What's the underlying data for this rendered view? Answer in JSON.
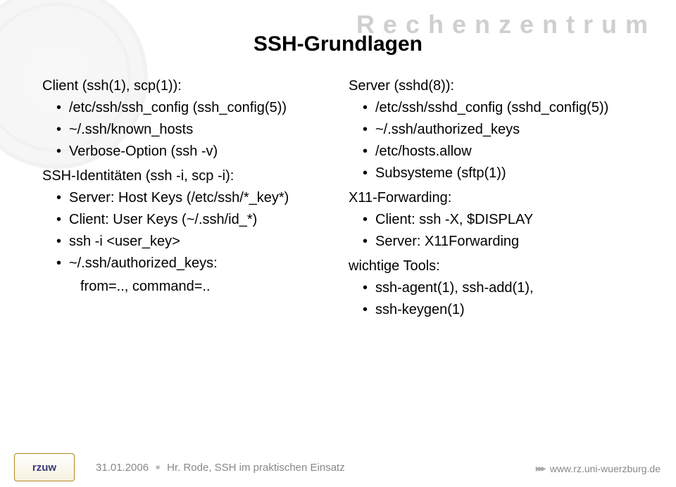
{
  "brand": "Rechenzentrum",
  "title": "SSH-Grundlagen",
  "left": {
    "s1": {
      "head": "Client (ssh(1), scp(1)):",
      "i0": "/etc/ssh/ssh_config (ssh_config(5))",
      "i1": "~/.ssh/known_hosts",
      "i2": "Verbose-Option (ssh -v)"
    },
    "s2": {
      "head": "SSH-Identitäten (ssh -i, scp -i):",
      "i0": "Server: Host Keys (/etc/ssh/*_key*)",
      "i1": "Client: User Keys (~/.ssh/id_*)",
      "i2": "ssh -i <user_key>",
      "i3": "~/.ssh/authorized_keys:",
      "i3a": "from=.., command=.."
    }
  },
  "right": {
    "s1": {
      "head": "Server (sshd(8)):",
      "i0": "/etc/ssh/sshd_config (sshd_config(5))",
      "i1": "~/.ssh/authorized_keys",
      "i2": "/etc/hosts.allow",
      "i3": "Subsysteme (sftp(1))"
    },
    "s2": {
      "head": "X11-Forwarding:",
      "i0": "Client: ssh -X, $DISPLAY",
      "i1": "Server: X11Forwarding"
    },
    "s3": {
      "head": "wichtige Tools:",
      "i0": "ssh-agent(1), ssh-add(1),",
      "i1": "ssh-keygen(1)"
    }
  },
  "footer": {
    "logo": "rzuw",
    "date": "31.01.2006",
    "subtitle": "Hr. Rode, SSH im praktischen Einsatz",
    "link": "www.rz.uni-wuerzburg.de"
  }
}
